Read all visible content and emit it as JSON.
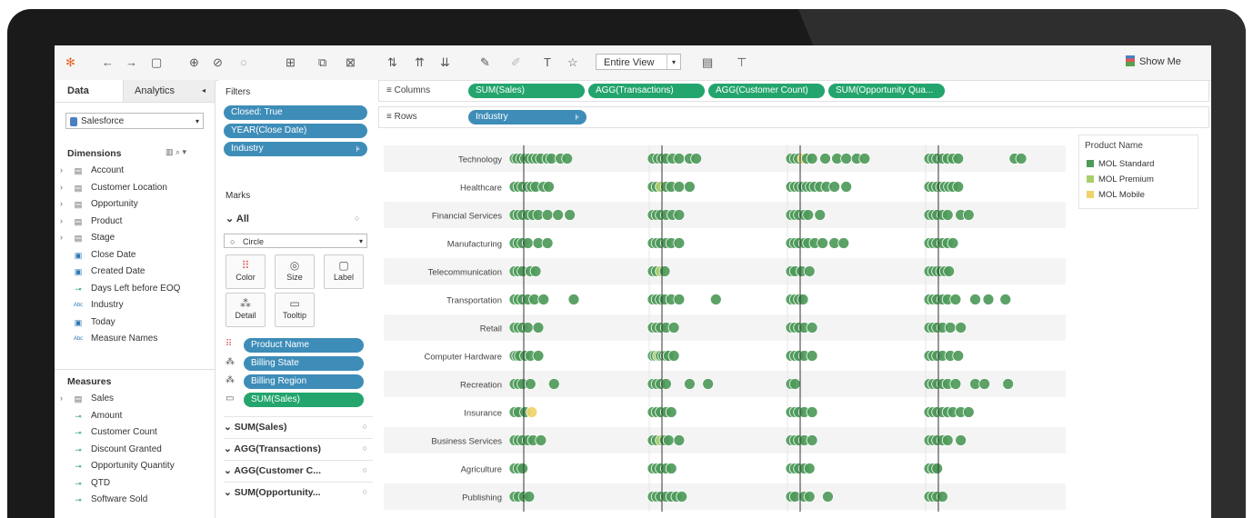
{
  "toolbar": {
    "entire_view": "Entire View",
    "show_me": "Show Me",
    "icons": [
      "tableau-logo-icon",
      "back-icon",
      "forward-icon",
      "save-icon",
      "new-datasource-icon",
      "pause-icon",
      "refresh-icon",
      "new-worksheet-icon",
      "duplicate-icon",
      "clear-icon",
      "swap-icon",
      "sort-asc-icon",
      "sort-desc-icon",
      "highlight-icon",
      "group-icon",
      "label-icon",
      "pin-icon",
      "cards-icon",
      "presentation-icon"
    ]
  },
  "data_pane": {
    "tab_data": "Data",
    "tab_analytics": "Analytics",
    "datasource": "Salesforce",
    "dimensions_label": "Dimensions",
    "dimensions": [
      {
        "label": "Account",
        "icon": "folder"
      },
      {
        "label": "Customer Location",
        "icon": "folder"
      },
      {
        "label": "Opportunity",
        "icon": "folder"
      },
      {
        "label": "Product",
        "icon": "folder"
      },
      {
        "label": "Stage",
        "icon": "folder"
      },
      {
        "label": "Close Date",
        "icon": "calendar"
      },
      {
        "label": "Created Date",
        "icon": "calendar"
      },
      {
        "label": "Days Left before EOQ",
        "icon": "measure"
      },
      {
        "label": "Industry",
        "icon": "abc"
      },
      {
        "label": "Today",
        "icon": "calendar"
      },
      {
        "label": "Measure Names",
        "icon": "abc"
      }
    ],
    "measures_label": "Measures",
    "measures": [
      {
        "label": "Sales",
        "icon": "folder"
      },
      {
        "label": "Amount",
        "icon": "measure"
      },
      {
        "label": "Customer Count",
        "icon": "measure"
      },
      {
        "label": "Discount Granted",
        "icon": "measure"
      },
      {
        "label": "Opportunity Quantity",
        "icon": "measure"
      },
      {
        "label": "QTD",
        "icon": "measure"
      },
      {
        "label": "Software Sold",
        "icon": "measure"
      }
    ]
  },
  "filters": {
    "label": "Filters",
    "items": [
      "Closed: True",
      "YEAR(Close Date)",
      "Industry"
    ]
  },
  "marks": {
    "label": "Marks",
    "all_label": "All",
    "mark_type": "Circle",
    "buttons": [
      "Color",
      "Size",
      "Label",
      "Detail",
      "Tooltip"
    ],
    "fields": [
      "Product Name",
      "Billing State",
      "Billing Region",
      "SUM(Sales)"
    ],
    "aggregates": [
      "SUM(Sales)",
      "AGG(Transactions)",
      "AGG(Customer C...",
      "SUM(Opportunity..."
    ]
  },
  "shelves": {
    "columns_label": "Columns",
    "columns": [
      "SUM(Sales)",
      "AGG(Transactions)",
      "AGG(Customer Count)",
      "SUM(Opportunity Qua..."
    ],
    "rows_label": "Rows",
    "rows": [
      "Industry"
    ]
  },
  "legend": {
    "title": "Product Name",
    "items": [
      {
        "label": "MOL Standard",
        "color": "#4e9a5a"
      },
      {
        "label": "MOL Premium",
        "color": "#a9cf6b"
      },
      {
        "label": "MOL Mobile",
        "color": "#f0d36b"
      }
    ]
  },
  "chart_data": {
    "type": "scatter",
    "categories": [
      "Technology",
      "Healthcare",
      "Financial Services",
      "Manufacturing",
      "Telecommunication",
      "Transportation",
      "Retail",
      "Computer Hardware",
      "Recreation",
      "Insurance",
      "Business Services",
      "Agriculture",
      "Publishing"
    ],
    "panes": [
      "SUM(Sales)",
      "AGG(Transactions)",
      "AGG(Customer Count)",
      "SUM(Opportunity Qua..."
    ],
    "colors": {
      "standard": "#4e9a5a",
      "premium": "#a9cf6b",
      "mobile": "#f0d36b"
    },
    "points": [
      [
        [
          0,
          0.02,
          0.05,
          0.08,
          0.11,
          0.14,
          0.17,
          0.2,
          0.25,
          0.28,
          0.35,
          0.4
        ],
        [
          0,
          0.04,
          0.07,
          0.1,
          0.15,
          0.2,
          0.28,
          0.33
        ],
        [
          0,
          0.03,
          0.06,
          0.09,
          0.12,
          0.16,
          0.26,
          0.35,
          0.42,
          0.5,
          0.56
        ],
        [
          0,
          0.03,
          0.06,
          0.1,
          0.14,
          0.18,
          0.22,
          0.65,
          0.7
        ]
      ],
      [
        [
          0,
          0.03,
          0.06,
          0.1,
          0.13,
          0.16,
          0.22,
          0.26
        ],
        [
          0,
          0.03,
          0.06,
          0.1,
          0.14,
          0.2,
          0.28
        ],
        [
          0,
          0.03,
          0.06,
          0.09,
          0.12,
          0.15,
          0.18,
          0.22,
          0.27,
          0.33,
          0.42
        ],
        [
          0,
          0.03,
          0.06,
          0.09,
          0.12,
          0.15,
          0.18,
          0.22
        ]
      ],
      [
        [
          0,
          0.03,
          0.06,
          0.1,
          0.14,
          0.18,
          0.25,
          0.33,
          0.42
        ],
        [
          0,
          0.03,
          0.06,
          0.1,
          0.15,
          0.2
        ],
        [
          0,
          0.03,
          0.06,
          0.1,
          0.13,
          0.22
        ],
        [
          0,
          0.03,
          0.06,
          0.1,
          0.14,
          0.24,
          0.3
        ]
      ],
      [
        [
          0,
          0.03,
          0.06,
          0.1,
          0.18,
          0.25
        ],
        [
          0,
          0.03,
          0.06,
          0.1,
          0.14,
          0.2
        ],
        [
          0,
          0.03,
          0.06,
          0.1,
          0.13,
          0.18,
          0.24,
          0.33,
          0.4
        ],
        [
          0,
          0.03,
          0.06,
          0.1,
          0.14,
          0.18
        ]
      ],
      [
        [
          0,
          0.03,
          0.06,
          0.12,
          0.16
        ],
        [
          0,
          0.03,
          0.06,
          0.09
        ],
        [
          0,
          0.03,
          0.08,
          0.14
        ],
        [
          0,
          0.03,
          0.06,
          0.09,
          0.12,
          0.15
        ]
      ],
      [
        [
          0,
          0.03,
          0.06,
          0.1,
          0.15,
          0.22,
          0.45
        ],
        [
          0,
          0.03,
          0.06,
          0.09,
          0.14,
          0.2,
          0.48
        ],
        [
          0,
          0.03,
          0.06,
          0.09
        ],
        [
          0,
          0.03,
          0.06,
          0.1,
          0.14,
          0.2,
          0.35,
          0.45,
          0.58
        ]
      ],
      [
        [
          0,
          0.03,
          0.06,
          0.1,
          0.18
        ],
        [
          0,
          0.03,
          0.06,
          0.1,
          0.16
        ],
        [
          0,
          0.03,
          0.06,
          0.1,
          0.16
        ],
        [
          0,
          0.03,
          0.06,
          0.1,
          0.16,
          0.24
        ]
      ],
      [
        [
          0,
          0.02,
          0.04,
          0.08,
          0.12,
          0.18
        ],
        [
          0,
          0.02,
          0.04,
          0.06,
          0.08,
          0.1,
          0.12,
          0.16
        ],
        [
          0,
          0.03,
          0.06,
          0.1,
          0.16
        ],
        [
          0,
          0.03,
          0.06,
          0.1,
          0.16,
          0.22
        ]
      ],
      [
        [
          0,
          0.03,
          0.06,
          0.12,
          0.3
        ],
        [
          0,
          0.03,
          0.06,
          0.1,
          0.28,
          0.42
        ],
        [
          0,
          0.03
        ],
        [
          0,
          0.03,
          0.06,
          0.1,
          0.14,
          0.2,
          0.35,
          0.42,
          0.6
        ]
      ],
      [
        [
          0,
          0.03,
          0.08,
          0.13
        ],
        [
          0,
          0.03,
          0.06,
          0.1,
          0.14
        ],
        [
          0,
          0.03,
          0.06,
          0.1,
          0.16
        ],
        [
          0,
          0.03,
          0.06,
          0.1,
          0.14,
          0.18,
          0.24,
          0.3
        ]
      ],
      [
        [
          0,
          0.03,
          0.06,
          0.1,
          0.14,
          0.2
        ],
        [
          0,
          0.03,
          0.06,
          0.09,
          0.12,
          0.2
        ],
        [
          0,
          0.03,
          0.06,
          0.1,
          0.16
        ],
        [
          0,
          0.03,
          0.06,
          0.1,
          0.14,
          0.24
        ]
      ],
      [
        [
          0,
          0.03,
          0.06
        ],
        [
          0,
          0.03,
          0.06,
          0.1,
          0.14
        ],
        [
          0,
          0.03,
          0.06,
          0.1,
          0.14
        ],
        [
          0,
          0.03,
          0.06
        ]
      ],
      [
        [
          0,
          0.03,
          0.07,
          0.11
        ],
        [
          0,
          0.03,
          0.06,
          0.1,
          0.14,
          0.18,
          0.22
        ],
        [
          0,
          0.03,
          0.1,
          0.14,
          0.28
        ],
        [
          0,
          0.03,
          0.06,
          0.1
        ]
      ]
    ],
    "premium_points": [
      [
        2,
        0.35
      ],
      [
        7,
        0.05
      ],
      [
        10,
        0.18
      ],
      [
        13,
        0.0
      ]
    ],
    "reference_line": "average"
  }
}
